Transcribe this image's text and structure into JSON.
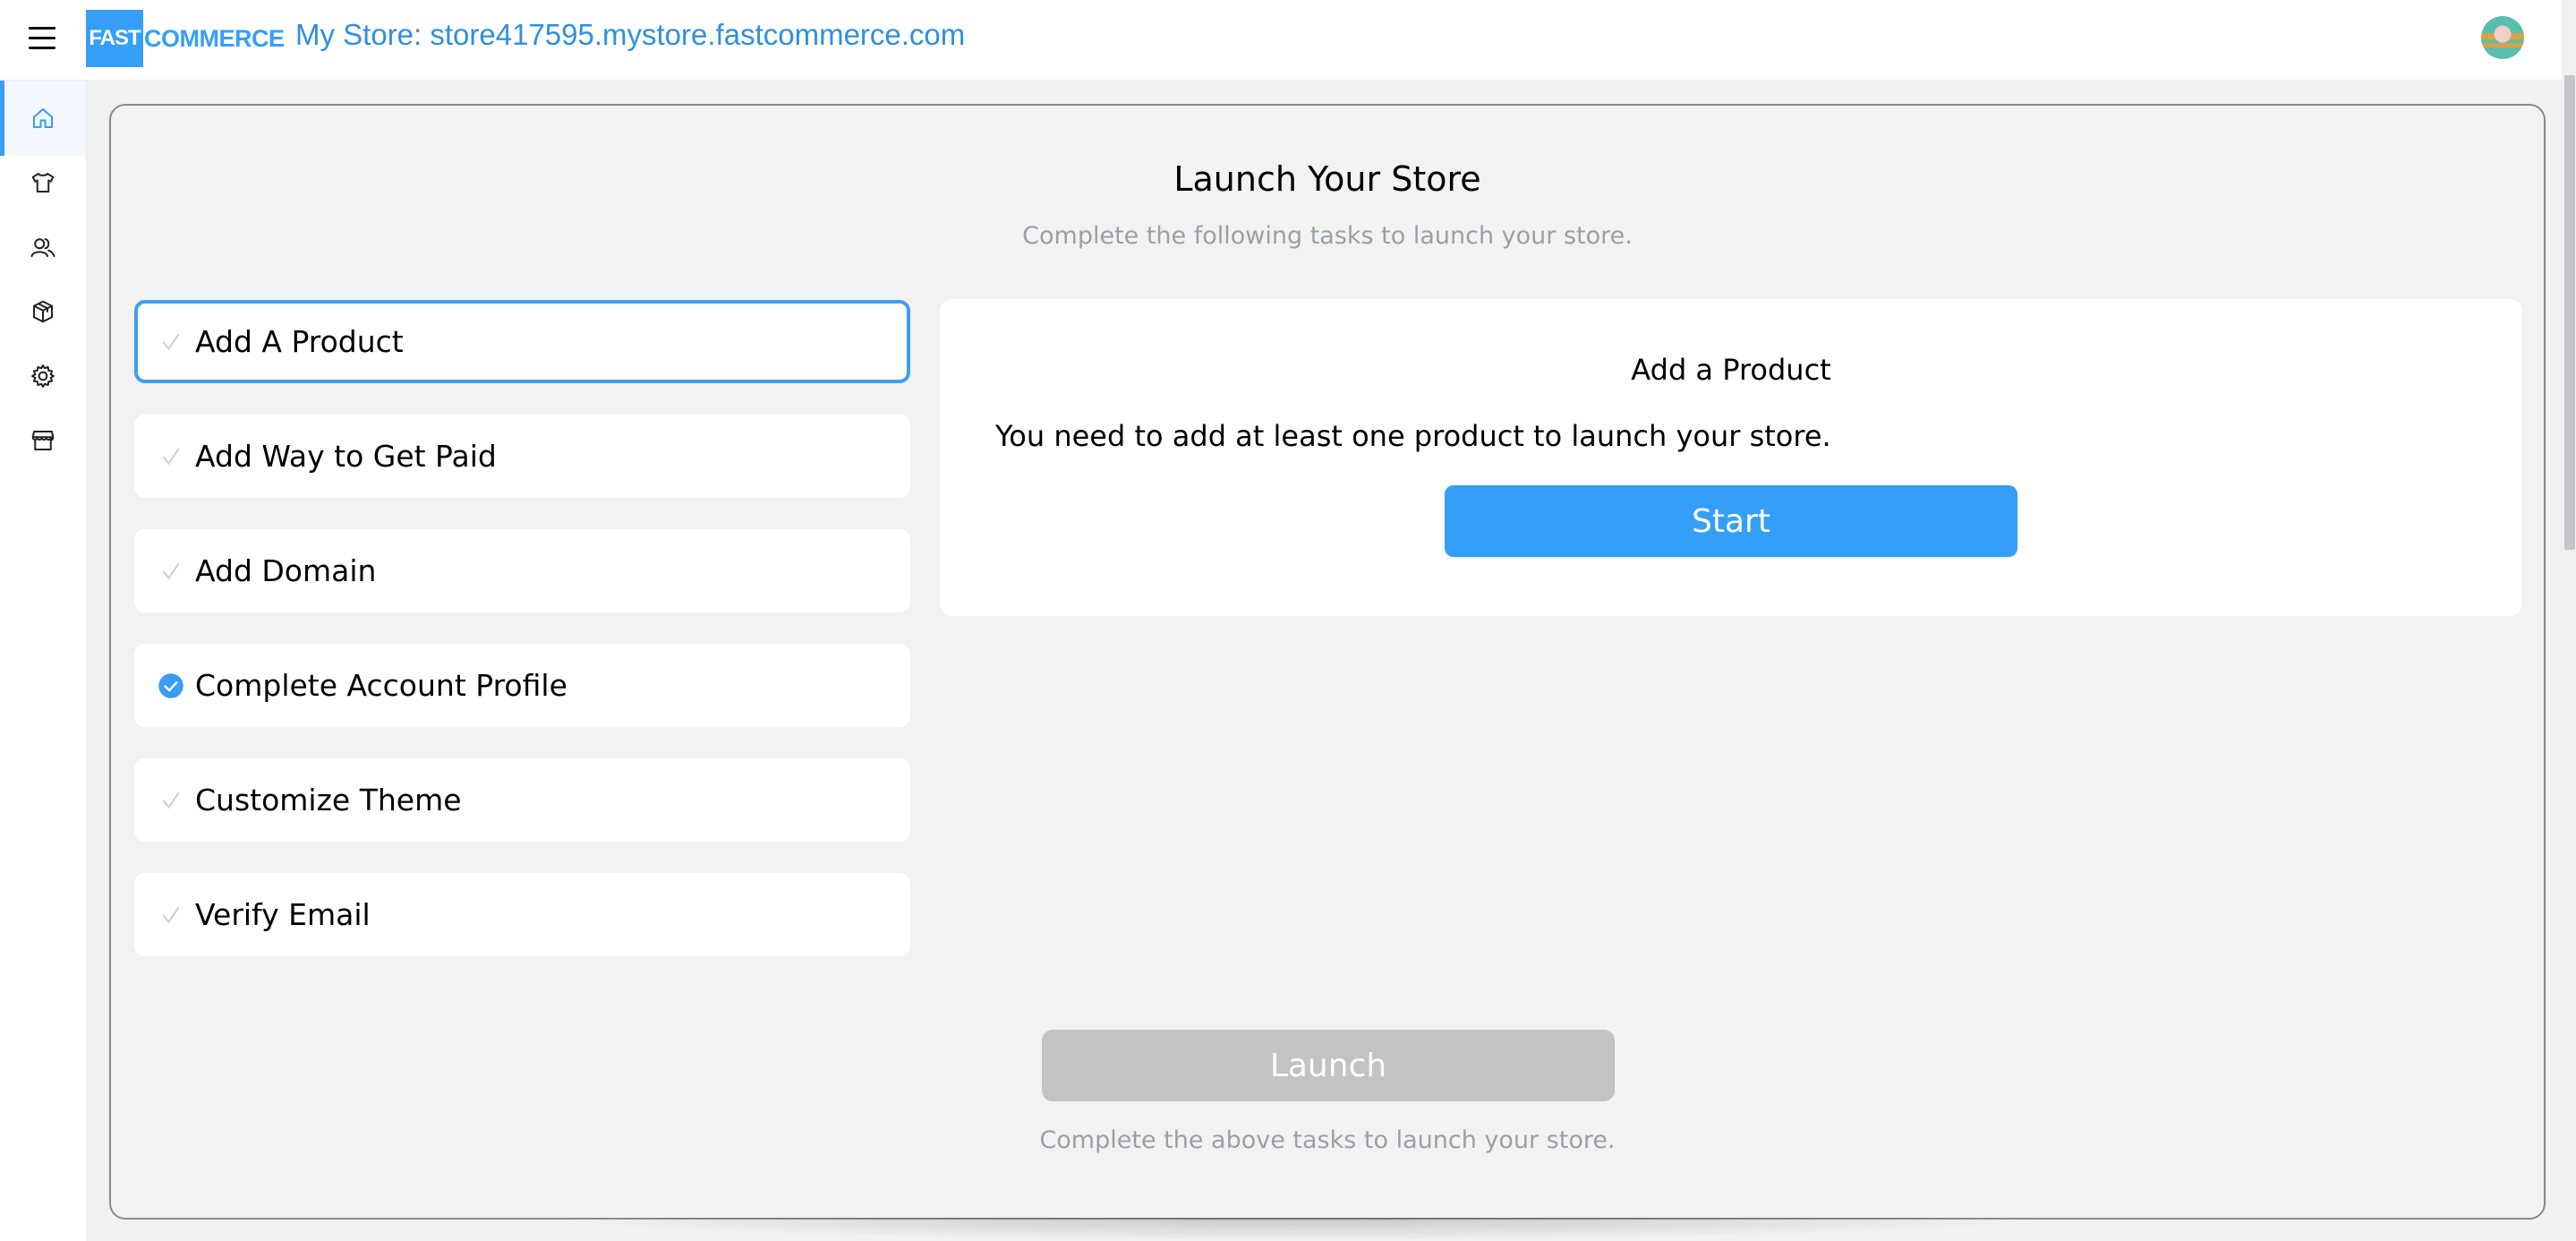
{
  "header": {
    "menu_icon": "hamburger-icon",
    "logo": {
      "part1": "FAST",
      "part2": "COMMERCE"
    },
    "store_title": "My Store: store417595.mystore.fastcommerce.com",
    "avatar_icon": "user-avatar"
  },
  "sidebar": {
    "items": [
      {
        "icon": "home-icon",
        "active": true
      },
      {
        "icon": "tshirt-icon",
        "active": false
      },
      {
        "icon": "users-icon",
        "active": false
      },
      {
        "icon": "box-icon",
        "active": false
      },
      {
        "icon": "gear-icon",
        "active": false
      },
      {
        "icon": "storefront-icon",
        "active": false
      }
    ]
  },
  "main": {
    "title": "Launch Your Store",
    "subtitle": "Complete the following tasks to launch your store.",
    "tasks": [
      {
        "label": "Add A Product",
        "completed": false,
        "selected": true
      },
      {
        "label": "Add Way to Get Paid",
        "completed": false,
        "selected": false
      },
      {
        "label": "Add Domain",
        "completed": false,
        "selected": false
      },
      {
        "label": "Complete Account Profile",
        "completed": true,
        "selected": false
      },
      {
        "label": "Customize Theme",
        "completed": false,
        "selected": false
      },
      {
        "label": "Verify Email",
        "completed": false,
        "selected": false
      }
    ],
    "detail": {
      "title": "Add a Product",
      "text": "You need to add at least one product to launch your store.",
      "button": "Start"
    },
    "launch": {
      "button": "Launch",
      "disabled": true,
      "note": "Complete the above tasks to launch your store."
    }
  },
  "colors": {
    "accent": "#359ff7",
    "disabled": "#c3c3c3",
    "muted_text": "#9aa0a9"
  }
}
